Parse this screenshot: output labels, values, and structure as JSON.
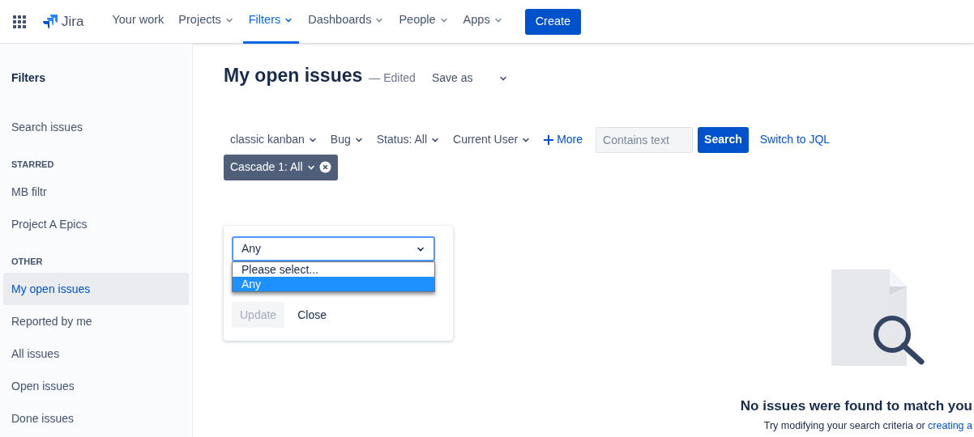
{
  "nav": {
    "product": "Jira",
    "items": [
      {
        "label": "Your work",
        "selected": false,
        "dropdown": false
      },
      {
        "label": "Projects",
        "selected": false,
        "dropdown": true
      },
      {
        "label": "Filters",
        "selected": true,
        "dropdown": true
      },
      {
        "label": "Dashboards",
        "selected": false,
        "dropdown": true
      },
      {
        "label": "People",
        "selected": false,
        "dropdown": true
      },
      {
        "label": "Apps",
        "selected": false,
        "dropdown": true
      }
    ],
    "create": "Create"
  },
  "sidebar": {
    "title": "Filters",
    "sections": [
      {
        "items": [
          {
            "label": "Search issues",
            "selected": false
          }
        ]
      },
      {
        "heading": "STARRED",
        "items": [
          {
            "label": "MB filtr",
            "selected": false
          },
          {
            "label": "Project A Epics",
            "selected": false
          }
        ]
      },
      {
        "heading": "OTHER",
        "items": [
          {
            "label": "My open issues",
            "selected": true
          },
          {
            "label": "Reported by me",
            "selected": false
          },
          {
            "label": "All issues",
            "selected": false
          },
          {
            "label": "Open issues",
            "selected": false
          },
          {
            "label": "Done issues",
            "selected": false
          }
        ]
      }
    ]
  },
  "page": {
    "title": "My open issues",
    "edited": "— Edited",
    "save_as": "Save as"
  },
  "filters": [
    {
      "label": "classic kanban"
    },
    {
      "label": "Bug"
    },
    {
      "label": "Status: All"
    },
    {
      "label": "Current User"
    }
  ],
  "more": "More",
  "search_placeholder": "Contains text",
  "search_button": "Search",
  "switch_jql": "Switch to JQL",
  "chip": {
    "label": "Cascade 1: All"
  },
  "popup": {
    "select_value": "Any",
    "options": [
      {
        "label": "Please select...",
        "selected": false
      },
      {
        "label": "Any",
        "selected": true
      }
    ],
    "update": "Update",
    "close": "Close"
  },
  "empty": {
    "heading": "No issues were found to match you",
    "text": "Try modifying your search criteria or ",
    "link": "creating a"
  }
}
